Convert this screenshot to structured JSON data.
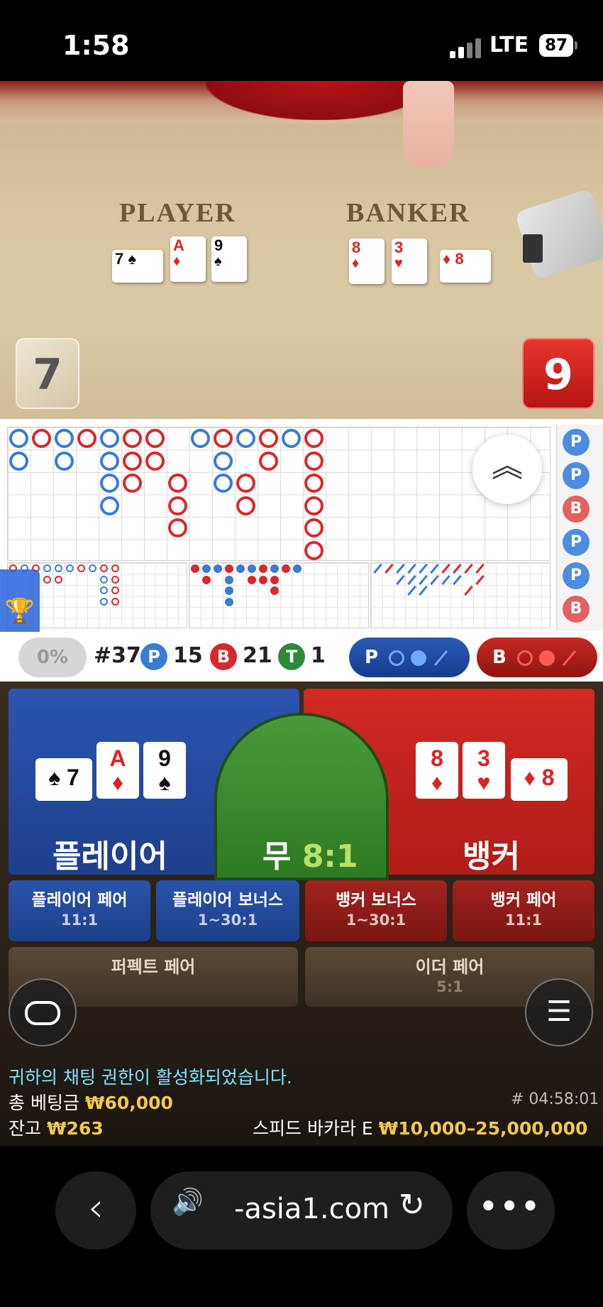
{
  "status_bar": {
    "time": "1:58",
    "network": "LTE",
    "battery": "87"
  },
  "table": {
    "player_label": "PLAYER",
    "banker_label": "BANKER",
    "player_cards": [
      {
        "rank": "7",
        "suit": "♠"
      },
      {
        "rank": "A",
        "suit": "♦"
      },
      {
        "rank": "9",
        "suit": "♠"
      }
    ],
    "banker_cards": [
      {
        "rank": "8",
        "suit": "♦"
      },
      {
        "rank": "3",
        "suit": "♥"
      },
      {
        "rank": "8",
        "suit": "♦"
      }
    ],
    "player_score": "7",
    "banker_score": "9"
  },
  "roadmap": {
    "predictions": [
      "P",
      "P",
      "B",
      "P",
      "P",
      "B"
    ],
    "round_number": "#37",
    "player_count": "15",
    "banker_count": "21",
    "tie_count": "1",
    "player_chip": "P",
    "banker_chip": "B",
    "tie_chip": "T",
    "win_percentage": "0%",
    "ask_player": "P",
    "ask_banker": "B"
  },
  "bets": {
    "player": "플레이어",
    "tie": "무",
    "tie_odds": "8:1",
    "banker": "뱅커",
    "side": [
      {
        "label": "플레이어 페어",
        "odds": "11:1"
      },
      {
        "label": "플레이어 보너스",
        "odds": "1~30:1"
      },
      {
        "label": "뱅커 보너스",
        "odds": "1~30:1"
      },
      {
        "label": "뱅커 페어",
        "odds": "11:1"
      }
    ],
    "perfect_pair": "퍼펙트 페어",
    "either_pair": "이더 페어",
    "either_odds": "5:1"
  },
  "info": {
    "chat_message": "귀하의 채팅 권한이 활성화되었습니다.",
    "total_bet_label": "총 베팅금",
    "total_bet": "₩60,000",
    "balance_label": "잔고",
    "balance": "₩263",
    "game_id": "# 04:58:01",
    "table_name": "스피드 바카라 E",
    "limits": "₩10,000–25,000,000"
  },
  "browser": {
    "url": "-asia1.com"
  },
  "colors": {
    "player_blue": "#2b55b0",
    "banker_red": "#d32a24",
    "tie_green": "#4a9a3a",
    "gold": "#f2c94c"
  }
}
